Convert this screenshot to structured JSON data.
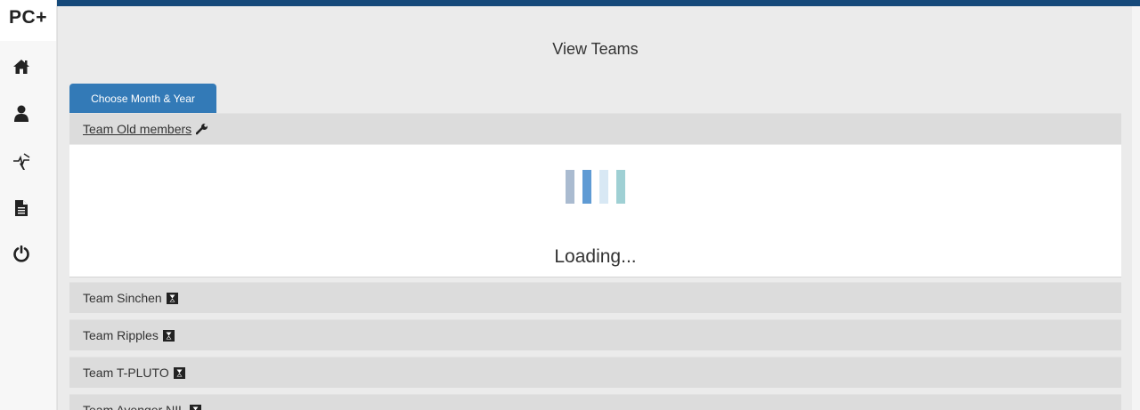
{
  "brand": "PC+",
  "sidebar": {
    "items": [
      {
        "name": "home-icon"
      },
      {
        "name": "user-icon"
      },
      {
        "name": "activity-icon"
      },
      {
        "name": "document-icon"
      },
      {
        "name": "power-icon"
      }
    ]
  },
  "colors": {
    "topbar": "#15497a",
    "button": "#337ab7",
    "row_bg": "#dcdcdc",
    "bar1": "#aabbd0",
    "bar2": "#5f9bd4",
    "bar3": "#d8e8f4",
    "bar4": "#9fd0d4"
  },
  "page": {
    "title": "View Teams"
  },
  "filter": {
    "button_label": "Choose Month & Year"
  },
  "teams": [
    {
      "label": "Team Old members",
      "icon": "wrench-icon",
      "expanded": true
    },
    {
      "label": "Team Sinchen",
      "icon": "hourglass-icon"
    },
    {
      "label": "Team Ripples",
      "icon": "hourglass-icon"
    },
    {
      "label": "Team T-PLUTO",
      "icon": "hourglass-icon"
    },
    {
      "label": "Team Avenger NIL",
      "icon": "hourglass-icon"
    }
  ],
  "loading": {
    "text": "Loading..."
  }
}
